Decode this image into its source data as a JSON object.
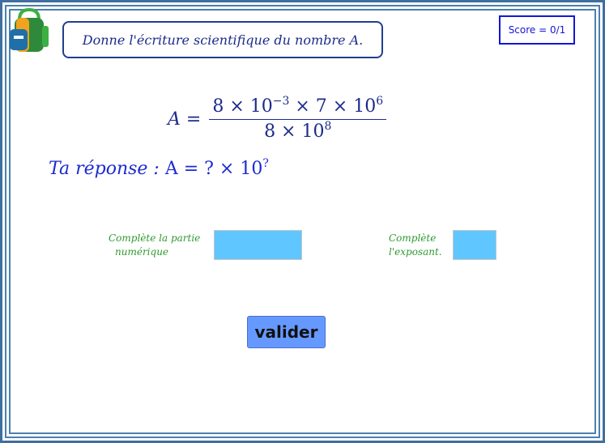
{
  "question": "Donne l'écriture scientifique du nombre A.",
  "score": "Score = 0/1",
  "equation": {
    "lhs": "A =",
    "numerator": {
      "a": "8 × 10",
      "a_exp": "−3",
      "b": " × 7 × 10",
      "b_exp": "6"
    },
    "denominator": {
      "a": "8 × 10",
      "a_exp": "8"
    }
  },
  "answer_prompt": {
    "text": "Ta réponse :",
    "expr": " A = ? × 10",
    "exp": "?"
  },
  "numeric_part": {
    "label_line1": "Complète la partie",
    "label_line2": "numérique",
    "value": ""
  },
  "exponent_part": {
    "label_line1": "Complète",
    "label_line2": "l'exposant.",
    "value": ""
  },
  "submit_label": "valider",
  "colors": {
    "frame": "#4d7fb0",
    "text_blue": "#1c2b8a",
    "label_green": "#2f9a2f",
    "input_bg": "#5fc6ff",
    "button_bg": "#6699ff",
    "score_border": "#1515d6"
  }
}
